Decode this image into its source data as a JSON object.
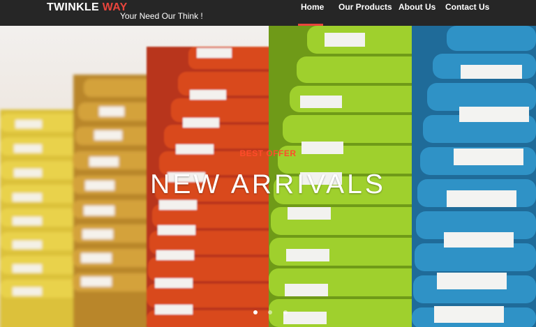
{
  "brand": {
    "name_part1": "TWINKLE",
    "name_part2": "WAY",
    "tagline": "Your Need Our Think !"
  },
  "nav": {
    "items": [
      {
        "label": "Home",
        "active": true
      },
      {
        "label": "Our Products"
      },
      {
        "label": "About Us"
      },
      {
        "label": "Contact Us"
      }
    ]
  },
  "hero": {
    "eyebrow": "BEST OFFER",
    "title": "NEW ARRIVALS",
    "slides_count": 3,
    "active_slide": 1
  },
  "colors": {
    "header_bg": "#262626",
    "accent": "#e8453c",
    "yellow": "#e3c63a",
    "mustard": "#c7962d",
    "orange": "#d6461c",
    "green": "#9bcb2a",
    "blue": "#2f8fc2"
  }
}
